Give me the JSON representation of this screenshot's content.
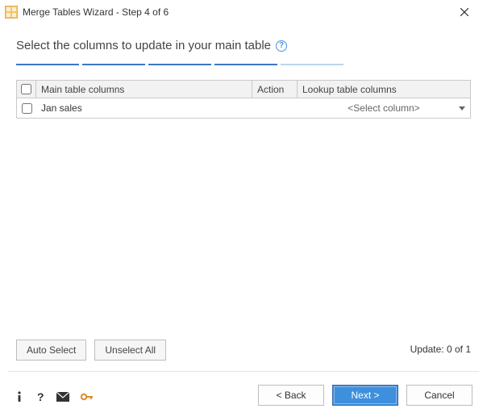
{
  "window": {
    "title": "Merge Tables Wizard - Step 4 of 6"
  },
  "heading": "Select the columns to update in your main table",
  "columns": {
    "main": "Main table columns",
    "action": "Action",
    "lookup": "Lookup table columns"
  },
  "rows": [
    {
      "checked": false,
      "main": "Jan sales",
      "action": "",
      "lookup": "<Select column>"
    }
  ],
  "buttons": {
    "auto_select": "Auto Select",
    "unselect_all": "Unselect All",
    "back": "< Back",
    "next": "Next >",
    "cancel": "Cancel"
  },
  "status": "Update: 0 of 1"
}
